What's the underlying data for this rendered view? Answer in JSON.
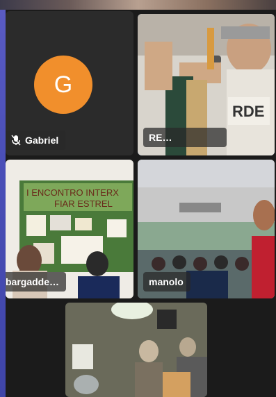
{
  "tiles": {
    "gabriel": {
      "initial": "G",
      "name": "Gabriel",
      "avatar_color": "#f18f2c"
    },
    "re": {
      "name": "RE…",
      "banner_text": "RDE"
    },
    "classroom": {
      "name": "bargadde…",
      "poster_line1": "I ENCONTRO INTERX",
      "poster_line2": "FIAR  ESTREL"
    },
    "auditorium": {
      "name": "manolo"
    },
    "room": {}
  },
  "colors": {
    "accent_speaking": "#4a8cf0",
    "avatar_bg": "#f18f2c"
  }
}
